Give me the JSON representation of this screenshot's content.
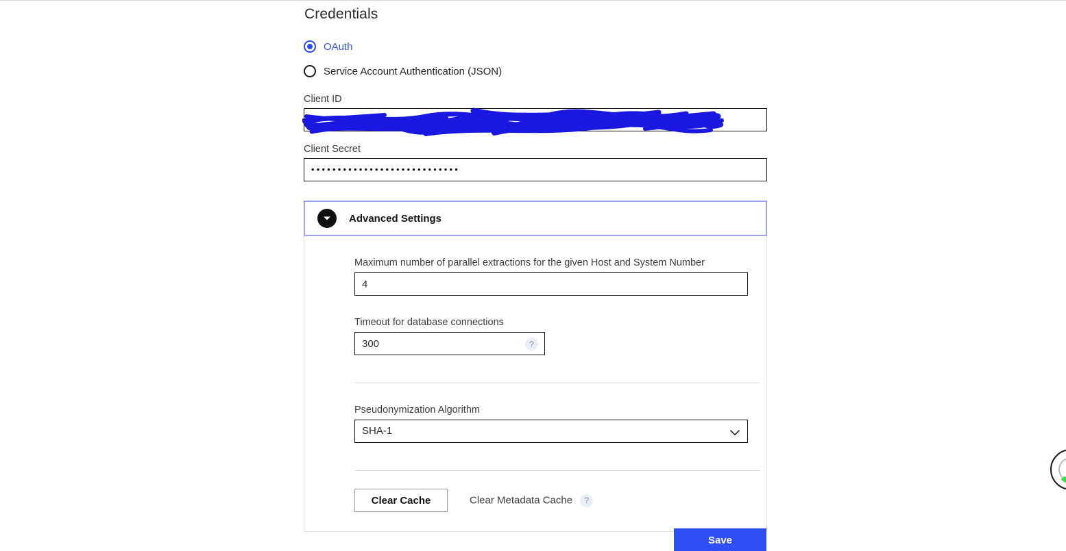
{
  "page": {
    "title": "Credentials"
  },
  "credentials": {
    "options": [
      {
        "label": "OAuth",
        "selected": true
      },
      {
        "label": "Service Account Authentication (JSON)",
        "selected": false
      }
    ],
    "client_id": {
      "label": "Client ID",
      "value": "",
      "placeholder": "",
      "redacted": true
    },
    "client_secret": {
      "label": "Client Secret",
      "value": "••••••••••••••••••••••••••••",
      "placeholder": ""
    }
  },
  "advanced": {
    "title": "Advanced Settings",
    "expanded": true,
    "parallel_extractions": {
      "label": "Maximum number of parallel extractions for the given Host and System Number",
      "value": "4",
      "placeholder": ""
    },
    "timeout": {
      "label": "Timeout for database connections",
      "value": "300",
      "placeholder": "",
      "help": "?"
    },
    "pseudonymization": {
      "label": "Pseudonymization Algorithm",
      "value": "SHA-1",
      "options": [
        "SHA-1"
      ]
    },
    "clear_cache_button": "Clear Cache",
    "clear_metadata_cache_link": "Clear Metadata Cache",
    "clear_metadata_cache_help": "?"
  },
  "footer": {
    "save_label": "Save"
  },
  "icons": {
    "collapse": "chevron-down-icon",
    "select_chevron": "chevron-down-icon",
    "sync": "sync-refresh-icon"
  },
  "colors": {
    "accent_blue": "#2f4ff6",
    "selected_radio": "#2b47f5",
    "panel_border": "#9aa4ef",
    "redaction_ink": "#1a18e0",
    "sync_green": "#3ddc4a"
  }
}
